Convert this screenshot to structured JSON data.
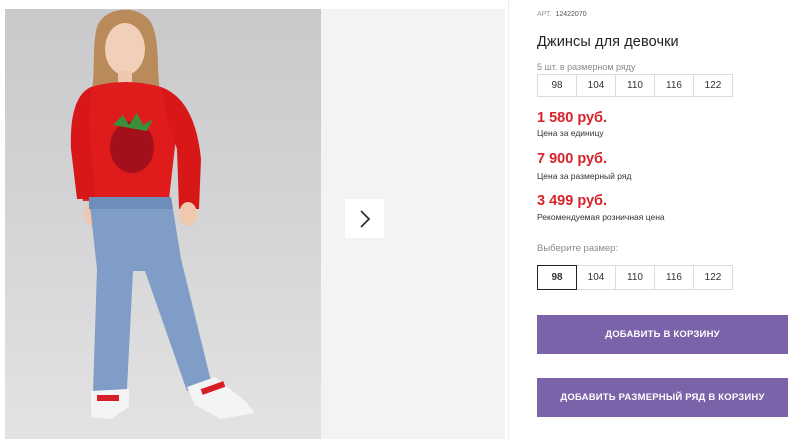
{
  "gallery": {
    "main_image_alt": "girl-in-red-strawberry-sweatshirt-and-jeans",
    "next_icon": "chevron-right-icon"
  },
  "product": {
    "art_label": "АРТ.",
    "art_value": "12422070",
    "title": "Джинсы для девочки",
    "set_note": "5 шт. в размерном ряду",
    "set_sizes": [
      "98",
      "104",
      "110",
      "116",
      "122"
    ],
    "prices": [
      {
        "value": "1 580 руб.",
        "label": "Цена за единицу"
      },
      {
        "value": "7 900 руб.",
        "label": "Цена за размерный ряд"
      },
      {
        "value": "3 499 руб.",
        "label": "Рекомендуемая розничная цена"
      }
    ],
    "choose_size_label": "Выберите размер:",
    "size_options": [
      "98",
      "104",
      "110",
      "116",
      "122"
    ],
    "selected_size": "98",
    "add_to_cart": "ДОБАВИТЬ В КОРЗИНУ",
    "add_set_to_cart": "ДОБАВИТЬ РАЗМЕРНЫЙ РЯД В КОРЗИНУ"
  },
  "colors": {
    "price": "#d8232a",
    "button": "#7c62a8"
  }
}
